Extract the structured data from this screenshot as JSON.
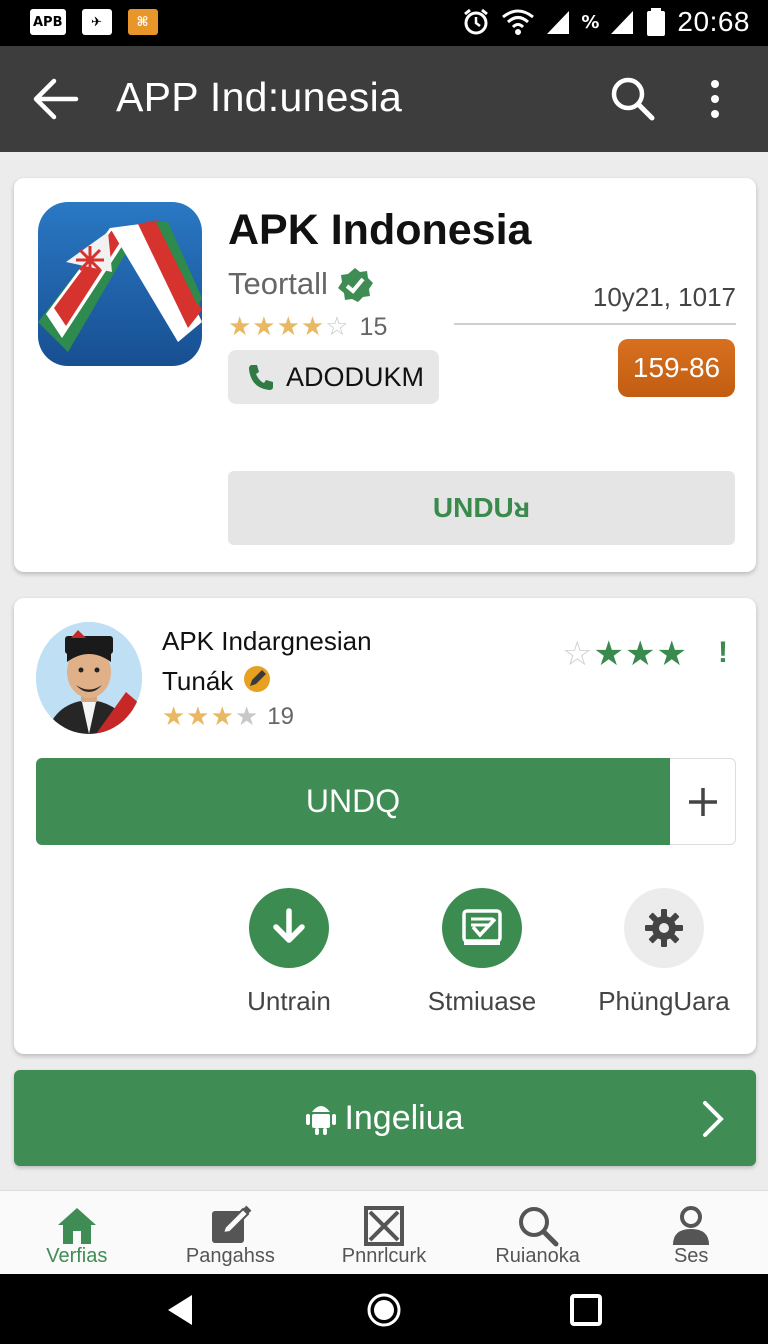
{
  "status_bar": {
    "badges": [
      "APB",
      "✈",
      "⌘"
    ],
    "signal_pct": "%",
    "time": "20:68"
  },
  "toolbar": {
    "title": "APP Ind:unesia"
  },
  "app_card": {
    "name": "APK Indonesia",
    "developer": "Teortall",
    "rating_stars": 3.5,
    "rating_count": "15",
    "tag_label": "ADODUKM",
    "date": "10y21, 1017",
    "size_badge": "159-86",
    "download_label": "UNDUᴚ"
  },
  "app_card2": {
    "name": "APK Indargnesian",
    "developer": "Tunák",
    "rating_stars": 3,
    "rating_count": "19",
    "green_stars_filled": 3,
    "alert_mark": "!",
    "download_label": "UNDQ",
    "actions": [
      {
        "icon": "download-icon",
        "label": "Untrain"
      },
      {
        "icon": "screen-icon",
        "label": "Stmiuase"
      },
      {
        "icon": "gear-icon",
        "label": "PhüngUara"
      }
    ]
  },
  "banner": {
    "label": "Ingeliua"
  },
  "bottom_nav": {
    "items": [
      {
        "icon": "home-icon",
        "label": "Verfias",
        "active": true
      },
      {
        "icon": "edit-icon",
        "label": "Pangahss"
      },
      {
        "icon": "box-x-icon",
        "label": "Pnnrlcurk"
      },
      {
        "icon": "search-icon",
        "label": "Ruianoka"
      },
      {
        "icon": "user-icon",
        "label": "Ses"
      }
    ]
  },
  "colors": {
    "toolbar": "#3d3d3d",
    "accent_green": "#3f8c55",
    "size_badge": "#d06a1a",
    "star_gold": "#e9b863"
  }
}
